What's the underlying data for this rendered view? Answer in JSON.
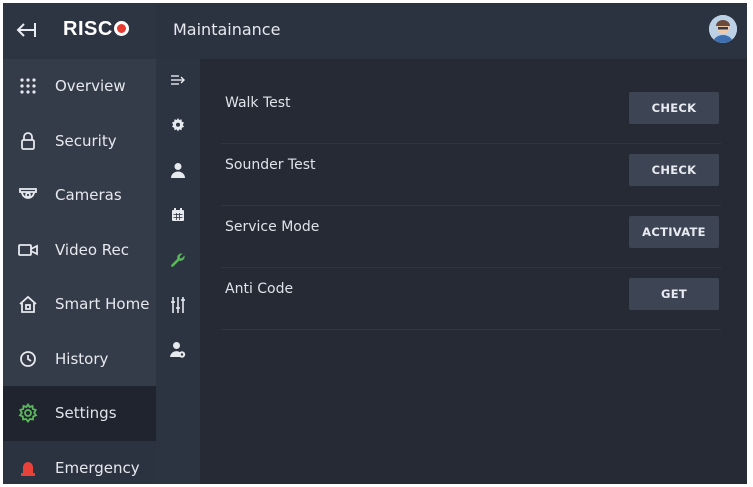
{
  "header": {
    "logo_text": "RISC",
    "page_title": "Maintainance"
  },
  "colors": {
    "sidebar_bg": "#343b49",
    "active_bg": "#1f242e",
    "content_bg": "#252a34",
    "button_bg": "#3d4453",
    "accent_green": "#5cb85c",
    "emergency_red": "#e8413a",
    "logo_red": "#e63b2e"
  },
  "sidebar": {
    "items": [
      {
        "label": "Overview",
        "icon": "grid-dots-icon"
      },
      {
        "label": "Security",
        "icon": "padlock-icon"
      },
      {
        "label": "Cameras",
        "icon": "dome-camera-icon"
      },
      {
        "label": "Video Rec",
        "icon": "video-camera-icon"
      },
      {
        "label": "Smart Home",
        "icon": "home-icon"
      },
      {
        "label": "History",
        "icon": "clock-history-icon"
      },
      {
        "label": "Settings",
        "icon": "gear-icon",
        "active": true
      },
      {
        "label": "Emergency",
        "icon": "siren-icon"
      }
    ]
  },
  "rail": {
    "items": [
      {
        "icon": "collapse-arrow-icon"
      },
      {
        "icon": "gear-small-icon"
      },
      {
        "icon": "user-icon"
      },
      {
        "icon": "calendar-icon"
      },
      {
        "icon": "wrench-icon",
        "active": true
      },
      {
        "icon": "sliders-icon"
      },
      {
        "icon": "user-settings-icon"
      }
    ]
  },
  "maintenance": {
    "rows": [
      {
        "label": "Walk Test",
        "button": "CHECK"
      },
      {
        "label": "Sounder Test",
        "button": "CHECK"
      },
      {
        "label": "Service Mode",
        "button": "ACTIVATE"
      },
      {
        "label": "Anti Code",
        "button": "GET"
      }
    ]
  }
}
